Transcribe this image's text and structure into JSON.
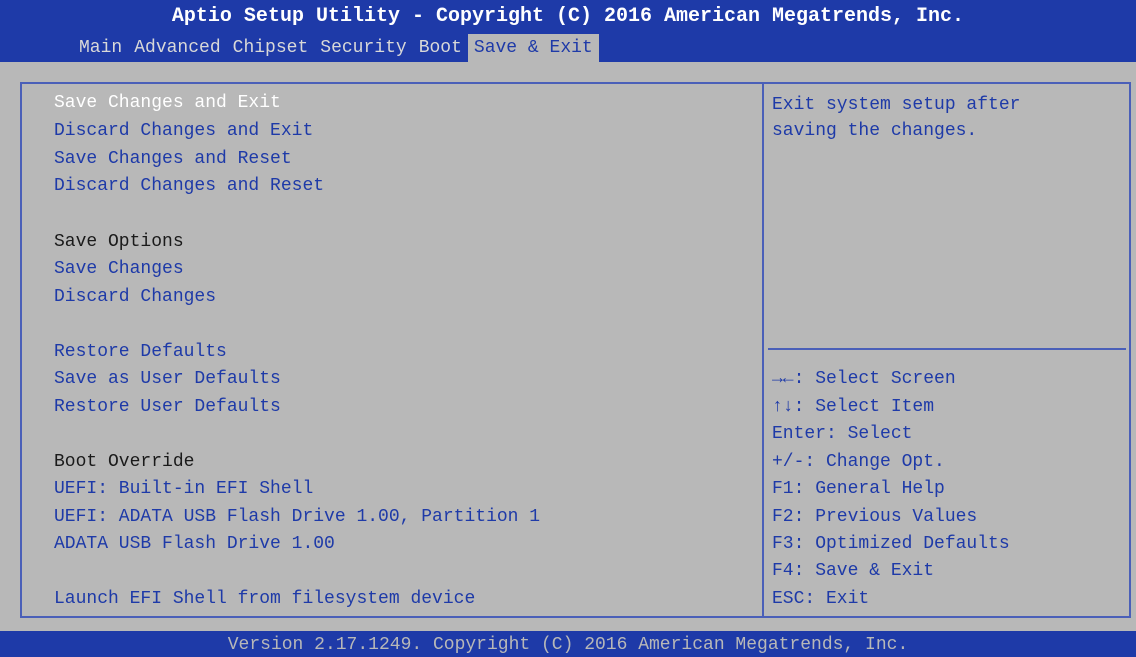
{
  "header": {
    "title": "Aptio Setup Utility - Copyright (C) 2016 American Megatrends, Inc.",
    "tabs": [
      "Main",
      "Advanced",
      "Chipset",
      "Security",
      "Boot",
      "Save & Exit"
    ],
    "active_tab": "Save & Exit"
  },
  "menu": {
    "save_changes_and_exit": "Save Changes and Exit",
    "discard_changes_and_exit": "Discard Changes and Exit",
    "save_changes_and_reset": "Save Changes and Reset",
    "discard_changes_and_reset": "Discard Changes and Reset",
    "save_options_label": "Save Options",
    "save_changes": "Save Changes",
    "discard_changes": "Discard Changes",
    "restore_defaults": "Restore Defaults",
    "save_as_user_defaults": "Save as User Defaults",
    "restore_user_defaults": "Restore User Defaults",
    "boot_override_label": "Boot Override",
    "uefi_builtin_shell": "UEFI: Built-in EFI Shell",
    "uefi_adata_usb": "UEFI: ADATA USB Flash Drive 1.00, Partition 1",
    "adata_usb": "ADATA USB Flash Drive 1.00",
    "launch_efi_shell": "Launch EFI Shell from filesystem device"
  },
  "help": {
    "text": "Exit system setup after\nsaving the changes.",
    "keys": [
      "→←: Select Screen",
      "↑↓: Select Item",
      "Enter: Select",
      "+/-: Change Opt.",
      "F1: General Help",
      "F2: Previous Values",
      "F3: Optimized Defaults",
      "F4: Save & Exit",
      "ESC: Exit"
    ]
  },
  "footer": {
    "version": "Version 2.17.1249. Copyright (C) 2016 American Megatrends, Inc."
  },
  "colors": {
    "bios_blue": "#1e3aa8",
    "bios_gray": "#b8b8b8",
    "selected_text": "#ffffff"
  }
}
